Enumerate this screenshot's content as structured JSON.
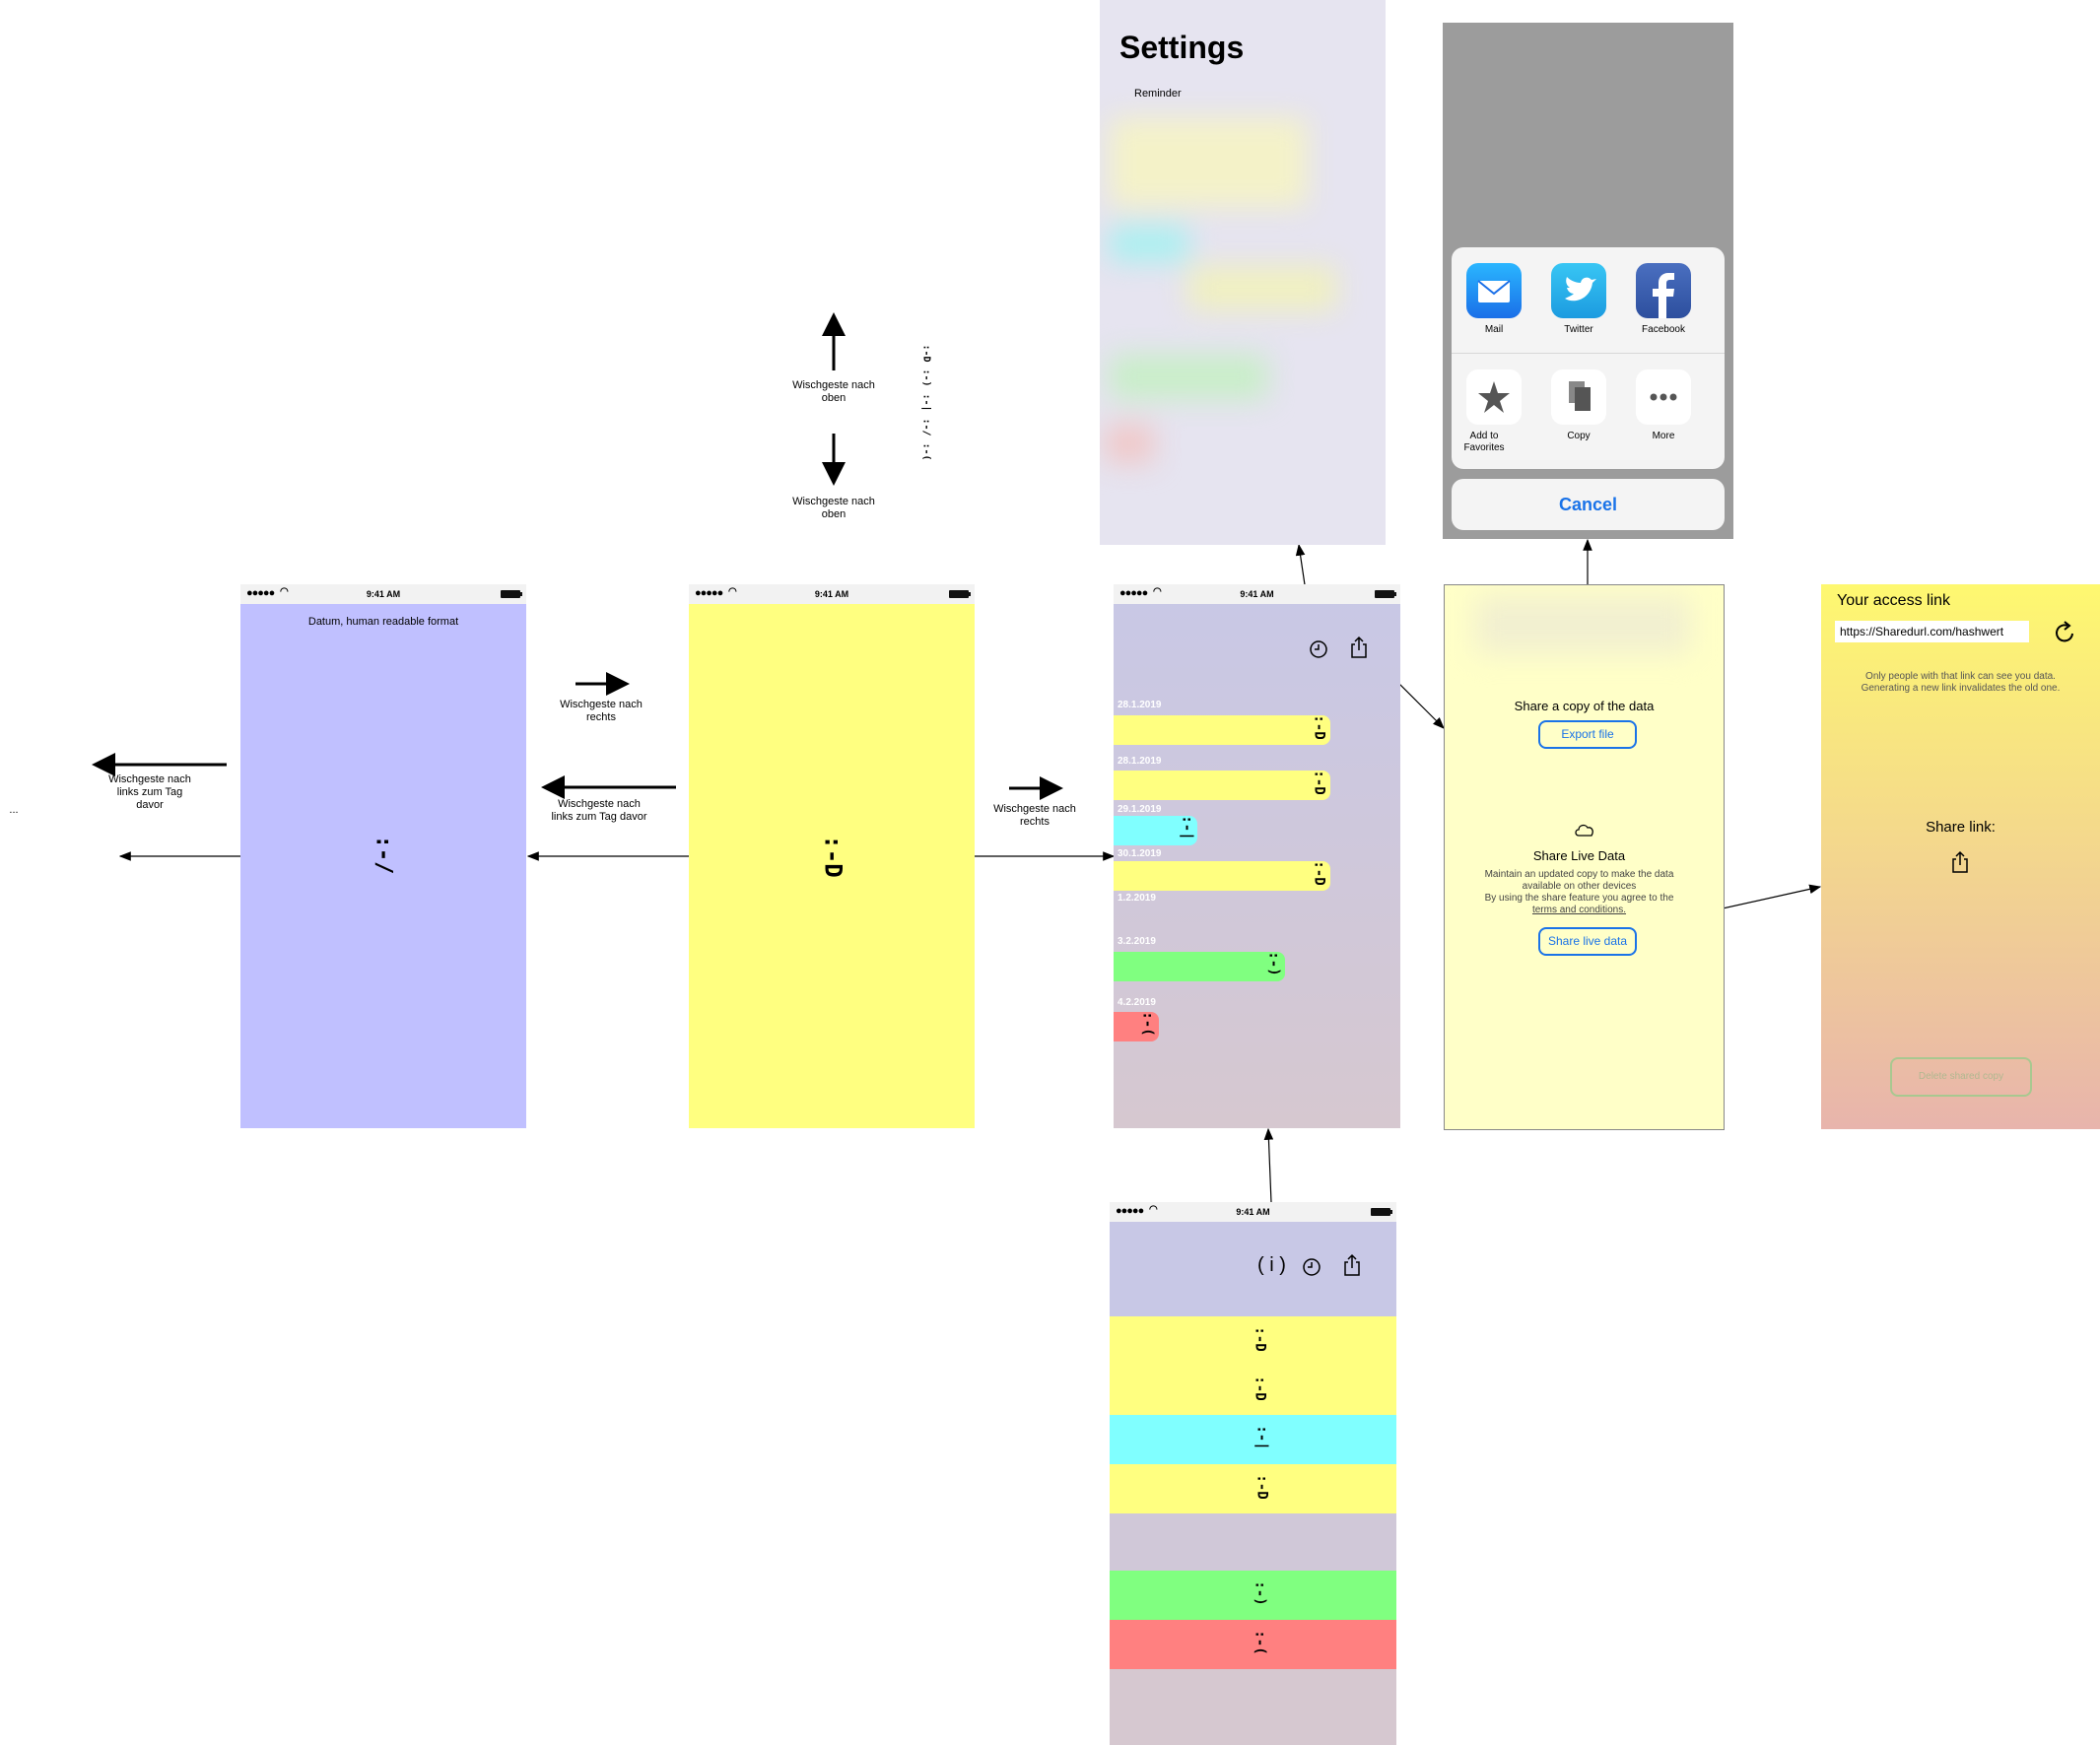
{
  "statusbar": {
    "time": "9:41 AM"
  },
  "ellipsis": "...",
  "screens": {
    "past_day": {
      "title": "Datum, human readable format",
      "face": ":-/"
    },
    "today": {
      "face": ":-D"
    },
    "history": {
      "entries": [
        {
          "date": "28.1.2019",
          "color": "#ffff80",
          "face": ":-D"
        },
        {
          "date": "28.1.2019",
          "color": "#ffff80",
          "face": ":-D"
        },
        {
          "date": "29.1.2019",
          "color": "#80ffff",
          "face": ":-|"
        },
        {
          "date": "30.1.2019",
          "color": "#ffff80",
          "face": ":-D"
        },
        {
          "date": "1.2.2019",
          "color": "",
          "face": ""
        },
        {
          "date": "3.2.2019",
          "color": "#80ff80",
          "face": ":-)"
        },
        {
          "date": "4.2.2019",
          "color": "#ff8080",
          "face": ":-("
        }
      ]
    },
    "settings": {
      "title": "Settings",
      "item": "Reminder"
    },
    "share_sheet": {
      "apps": [
        {
          "label": "Mail",
          "icon": "mail-icon"
        },
        {
          "label": "Twitter",
          "icon": "twitter-icon"
        },
        {
          "label": "Facebook",
          "icon": "facebook-icon"
        }
      ],
      "actions": [
        {
          "label": "Add to Favorites",
          "icon": "star-icon"
        },
        {
          "label": "Copy",
          "icon": "copy-icon"
        },
        {
          "label": "More",
          "icon": "more-icon"
        }
      ],
      "cancel": "Cancel"
    },
    "share_data": {
      "copy_heading": "Share a copy of the data",
      "export_button": "Export file",
      "live_heading": "Share Live Data",
      "live_desc1": "Maintain an updated copy to make the data",
      "live_desc2": "available on other devices",
      "live_desc3": "By using the share feature you agree to the",
      "terms_link": "terms and conditions.",
      "live_button": "Share live data"
    },
    "access_link": {
      "title": "Your access link",
      "url": "https://Sharedurl.com/hashwert",
      "note1": "Only people with that link can see you data.",
      "note2": "Generating a new link invalidates the old one.",
      "share_label": "Share link:",
      "delete_button": "Delete shared copy"
    },
    "overview": {
      "info": "( i )",
      "rows": [
        {
          "color": "#ffff80",
          "face": ":-D"
        },
        {
          "color": "#ffff80",
          "face": ":-D"
        },
        {
          "color": "#80ffff",
          "face": ":-|"
        },
        {
          "color": "#ffff80",
          "face": ":-D"
        },
        {
          "color": "#d0c8d8",
          "face": ""
        },
        {
          "color": "#80ff80",
          "face": ":-)"
        },
        {
          "color": "#ff8080",
          "face": ":-("
        }
      ]
    }
  },
  "annotations": {
    "swipe_up": "Wischgeste nach oben",
    "swipe_down": "Wischgeste nach oben",
    "swipe_right_1": "Wischgeste nach rechts",
    "swipe_left_1": "Wischgeste nach links zum Tag davor",
    "swipe_left_2": "Wischgeste nach links zum Tag davor",
    "swipe_right_2": "Wischgeste nach rechts",
    "mood_scale": [
      ":-D",
      ":-)",
      ":-|",
      ":-/",
      ":-("
    ]
  }
}
